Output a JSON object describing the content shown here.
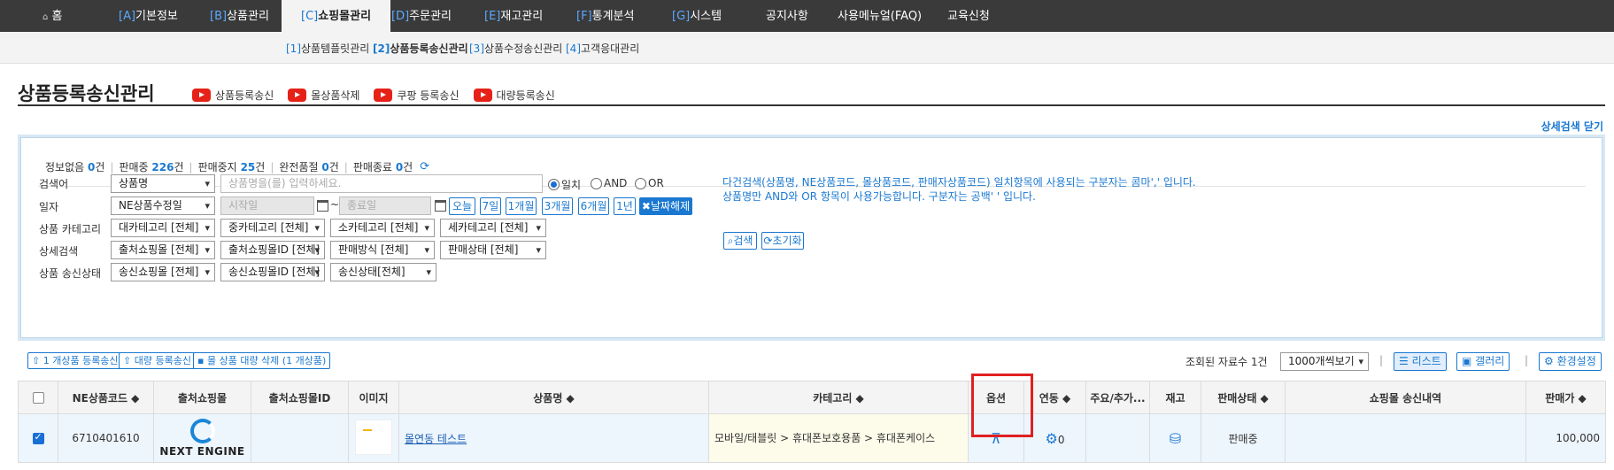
{
  "nav": {
    "home": "홈",
    "items": [
      {
        "prefix": "[A]",
        "label": "기본정보"
      },
      {
        "prefix": "[B]",
        "label": "상품관리"
      },
      {
        "prefix": "[C]",
        "label": "쇼핑몰관리"
      },
      {
        "prefix": "[D]",
        "label": "주문관리"
      },
      {
        "prefix": "[E]",
        "label": "재고관리"
      },
      {
        "prefix": "[F]",
        "label": "통계분석"
      },
      {
        "prefix": "[G]",
        "label": "시스템"
      }
    ],
    "extra": [
      "공지사항",
      "사용메뉴얼(FAQ)",
      "교육신청"
    ]
  },
  "subnav": [
    {
      "prefix": "[1]",
      "label": "상품템플릿관리"
    },
    {
      "prefix": "[2]",
      "label": "상품등록송신관리"
    },
    {
      "prefix": "[3]",
      "label": "상품수정송신관리"
    },
    {
      "prefix": "[4]",
      "label": "고객응대관리"
    }
  ],
  "page": {
    "title": "상품등록송신관리",
    "video_links": [
      "상품등록송신",
      "몰상품삭제",
      "쿠팡 등록송신",
      "대량등록송신"
    ],
    "detail_close": "상세검색 닫기"
  },
  "status": [
    {
      "label": "정보없음",
      "count": "0",
      "unit": "건"
    },
    {
      "label": "판매중",
      "count": "226",
      "unit": "건"
    },
    {
      "label": "판매중지",
      "count": "25",
      "unit": "건"
    },
    {
      "label": "완전품절",
      "count": "0",
      "unit": "건"
    },
    {
      "label": "판매종료",
      "count": "0",
      "unit": "건"
    }
  ],
  "search": {
    "keyword_label": "검색어",
    "keyword_type": "상품명",
    "keyword_placeholder": "상품명을(를) 입력하세요.",
    "match": [
      "일치",
      "AND",
      "OR"
    ],
    "date_label": "일자",
    "date_type": "NE상품수정일",
    "start_placeholder": "시작일",
    "end_placeholder": "종료일",
    "tilde": "~",
    "date_buttons": [
      "오늘",
      "7일",
      "1개월",
      "3개월",
      "6개월",
      "1년"
    ],
    "date_clear": "✖날짜해제",
    "category_label": "상품 카테고리",
    "categories": [
      "대카테고리 [전체]",
      "중카테고리 [전체]",
      "소카테고리 [전체]",
      "세카테고리 [전체]"
    ],
    "detail_label": "상세검색",
    "details": [
      "출처쇼핑몰 [전체]",
      "출처쇼핑몰ID [전체]",
      "판매방식 [전체]",
      "판매상태 [전체]"
    ],
    "send_label": "상품 송신상태",
    "sends": [
      "송신쇼핑몰 [전체]",
      "송신쇼핑몰ID [전체]",
      "송신상태[전체]"
    ],
    "help_1": "다건검색(상품명, NE상품코드, 몰상품코드, 판매자상품코드) 일치항목에 사용되는 구분자는 콤마',' 입니다.",
    "help_2": "상품명만 AND와 OR 항목이 사용가능합니다. 구분자는 공백' ' 입니다.",
    "search_btn": "검색",
    "reset_btn": "초기화"
  },
  "actions": {
    "btn1": "1 개상품 등록송신",
    "btn2": "대량 등록송신",
    "btn3": "몰 상품 대량 삭제 (1 개상품)",
    "count": "조회된 자료수 1건",
    "page_size": "1000개씩보기",
    "list": "리스트",
    "gallery": "갤러리",
    "settings": "환경설정"
  },
  "table": {
    "headers": [
      "NE상품코드 ◆",
      "출처쇼핑몰",
      "출처쇼핑몰ID",
      "이미지",
      "상품명 ◆",
      "카테고리 ◆",
      "옵션",
      "연동 ◆",
      "주요/추가...",
      "재고",
      "판매상태 ◆",
      "쇼핑몰 송신내역",
      "판매가 ◆"
    ],
    "row": {
      "code": "6710401610",
      "mall_logo": "NEXT ENGINE",
      "name": "몰연동 테스트",
      "category": "모바일/태블릿 > 휴대폰보호용품 > 휴대폰케이스",
      "link_count": "0",
      "status": "판매중",
      "price": "100,000"
    }
  }
}
